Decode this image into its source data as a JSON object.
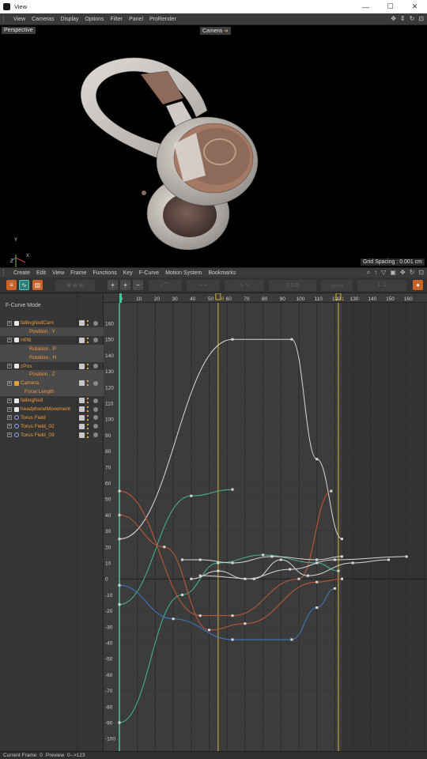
{
  "window": {
    "title": "View",
    "controls": [
      "—",
      "☐",
      "✕"
    ]
  },
  "viewport_menu": [
    "View",
    "Cameras",
    "Display",
    "Options",
    "Filter",
    "Panel",
    "ProRender"
  ],
  "viewport": {
    "projection_label": "Perspective",
    "camera_label": "Camera",
    "grid_spacing": "Grid Spacing : 0.001 cm",
    "axis_labels": [
      "Y",
      "Z",
      "X"
    ]
  },
  "timeline_menu": [
    "Create",
    "Edit",
    "View",
    "Frame",
    "Functions",
    "Key",
    "F-Curve",
    "Motion System",
    "Bookmarks"
  ],
  "mode_label": "F-Curve Mode",
  "tree": [
    {
      "name": "fallingNullCam",
      "indent": 0,
      "type": "null",
      "expand": true
    },
    {
      "name": "Position . Y",
      "indent": 2,
      "type": "track"
    },
    {
      "name": "HPB",
      "indent": 0,
      "type": "null",
      "expand": true
    },
    {
      "name": "Rotation . P",
      "indent": 2,
      "type": "track"
    },
    {
      "name": "Rotation . H",
      "indent": 2,
      "type": "track"
    },
    {
      "name": "zPos",
      "indent": 0,
      "type": "null",
      "expand": true
    },
    {
      "name": "Position . Z",
      "indent": 2,
      "type": "track"
    },
    {
      "name": "Camera",
      "indent": 0,
      "type": "camera",
      "expand": true
    },
    {
      "name": "Focal Length",
      "indent": 1,
      "type": "track"
    },
    {
      "name": "fallingNull",
      "indent": 0,
      "type": "null",
      "expand": true
    },
    {
      "name": "headphoneMovement",
      "indent": 0,
      "type": "null",
      "expand": true
    },
    {
      "name": "Torus Field",
      "indent": 0,
      "type": "field",
      "expand": true
    },
    {
      "name": "Torus Field_02",
      "indent": 0,
      "type": "field",
      "expand": true
    },
    {
      "name": "Torus Field_03",
      "indent": 0,
      "type": "field",
      "expand": true
    }
  ],
  "ruler": {
    "ticks": [
      "0",
      "10",
      "20",
      "30",
      "40",
      "50",
      "60",
      "70",
      "80",
      "90",
      "100",
      "110",
      "120",
      "130",
      "140",
      "150",
      "160"
    ],
    "marker_a": "0",
    "marker_b": "1"
  },
  "graph_labels": [
    "160",
    "150",
    "140",
    "130",
    "120",
    "110",
    "100",
    "90",
    "80",
    "70",
    "60",
    "50",
    "40",
    "30",
    "20",
    "10",
    "0",
    "-10",
    "-20",
    "-30",
    "-40",
    "-50",
    "-60",
    "-70",
    "-80",
    "-90",
    "-100"
  ],
  "status": {
    "current_frame_label": "Current Frame",
    "current_frame": "0",
    "preview_label": "Preview",
    "preview_range": "0-->123"
  },
  "colors": {
    "curve_white": "#d8d8d8",
    "curve_green": "#48b894",
    "curve_red": "#c2593a",
    "curve_blue": "#3e7bc4",
    "playhead": "#3ec9a0",
    "bookmark": "#d9b235"
  },
  "icons": [
    "app-icon",
    "move-icon",
    "zoom-icon",
    "rotate-icon",
    "maximize-icon"
  ]
}
